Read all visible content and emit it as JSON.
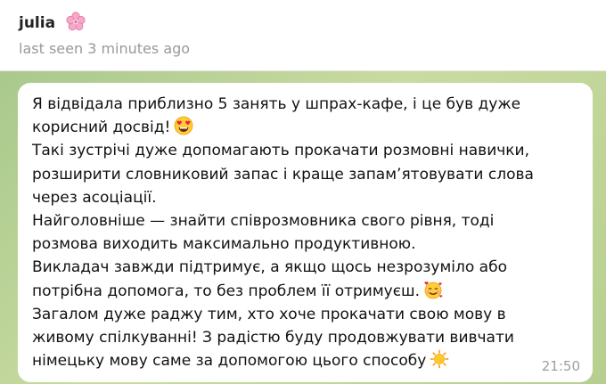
{
  "header": {
    "contact_name": "julia",
    "contact_emoji_icon": "cherry-blossom-icon",
    "status": "last seen 3 minutes ago"
  },
  "message": {
    "lines": [
      "Я відвідала приблизно 5 занять у шпрах-кафе, і це був дуже",
      "корисний досвід!",
      "Такі зустрічі дуже допомагають прокачати розмовні навички,",
      "розширити словниковий запас і краще запам’ятовувати слова",
      "через асоціації.",
      "Найголовніше — знайти співрозмовника свого рівня, тоді",
      "розмова виходить максимально продуктивною.",
      "Викладач завжди підтримує, а якщо щось незрозуміло або",
      "потрібна допомога, то без проблем її отримуєш.",
      "Загалом дуже раджу тим, хто хоче прокачати свою мову в",
      "живому спілкуванні! З радістю буду продовжувати вивчати",
      "німецьку мову саме за допомогою цього способу"
    ],
    "emoji_icons": [
      "heart-eyes-emoji-icon",
      "smiling-face-with-hearts-emoji-icon",
      "sun-emoji-icon"
    ],
    "time": "21:50"
  },
  "colors": {
    "chat_background": "#b6cf8f",
    "bubble": "#ffffff",
    "time_text": "#9aa0a6"
  }
}
